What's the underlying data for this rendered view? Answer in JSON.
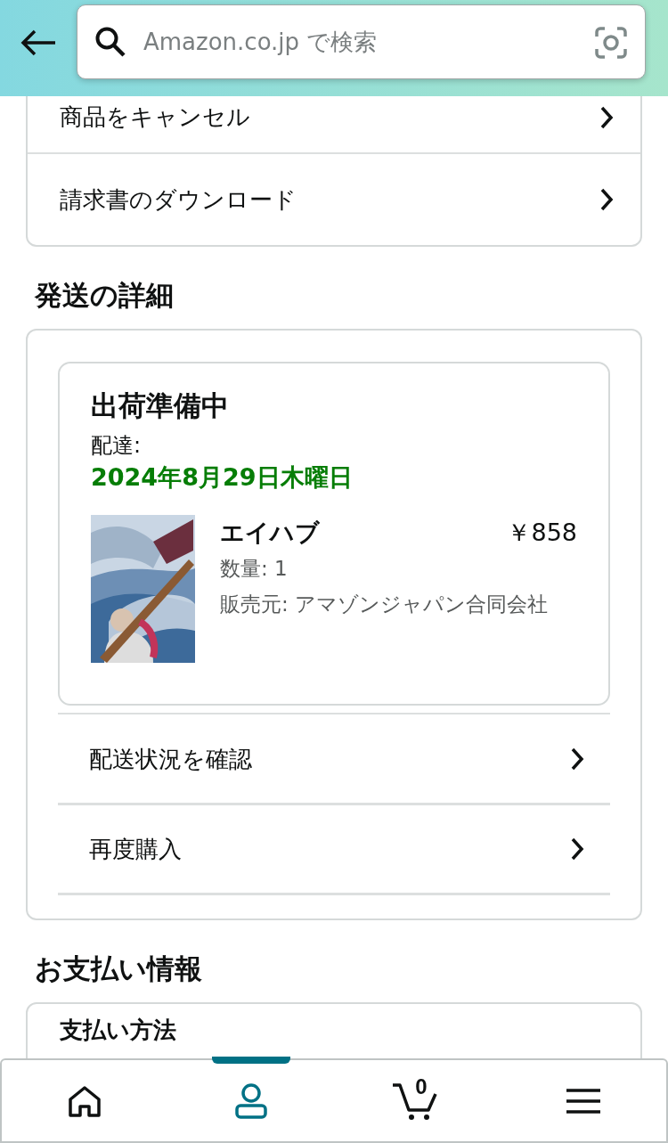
{
  "header": {
    "search": {
      "placeholder": "Amazon.co.jp で検索"
    }
  },
  "order_actions": [
    {
      "label": "商品をキャンセル"
    },
    {
      "label": "請求書のダウンロード"
    }
  ],
  "shipping": {
    "heading": "発送の詳細",
    "status": "出荷準備中",
    "delivery_label": "配達:",
    "delivery_date": "2024年8月29日木曜日",
    "item": {
      "name": "エイハブ",
      "price": "￥858",
      "quantity": "数量: 1",
      "seller": "販売元: アマゾンジャパン合同会社"
    },
    "actions": [
      {
        "label": "配送状況を確認"
      },
      {
        "label": "再度購入"
      }
    ]
  },
  "payment": {
    "heading": "お支払い情報",
    "rows": [
      {
        "label": "支払い方法"
      }
    ]
  },
  "nav": [
    {
      "kind": "home",
      "selected": false
    },
    {
      "kind": "account",
      "selected": true
    },
    {
      "kind": "cart",
      "selected": false,
      "count": "0"
    },
    {
      "kind": "menu",
      "selected": false
    }
  ]
}
